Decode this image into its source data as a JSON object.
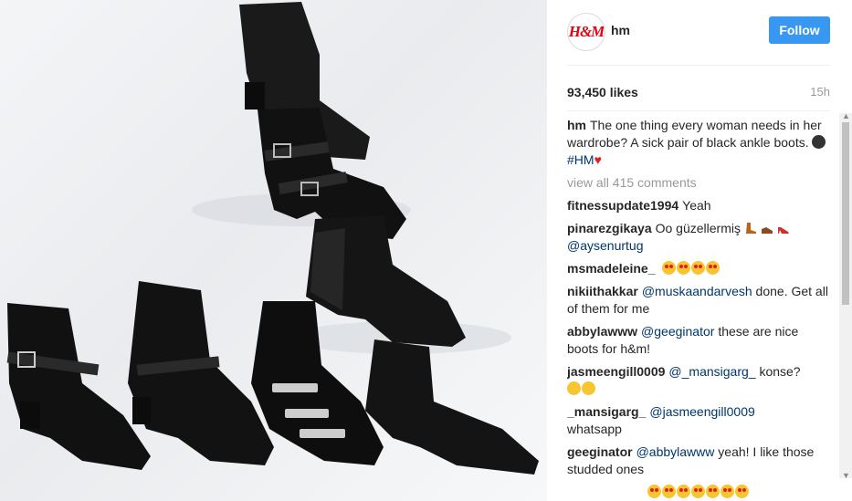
{
  "post": {
    "username": "hm",
    "avatar_text": "H&M",
    "follow_label": "Follow",
    "likes": "93,450 likes",
    "time": "15h",
    "caption_user": "hm",
    "caption_text": "The one thing every woman needs in her wardrobe? A sick pair of black ankle boots.",
    "caption_hashtag": "#HM",
    "view_all": "view all 415 comments"
  },
  "comments": [
    {
      "user": "fitnessupdate1994",
      "text": "Yeah"
    },
    {
      "user": "pinarezgikaya",
      "text": "Oo güzellermiş",
      "mention": "@aysenurtug"
    },
    {
      "user": "msmadeleine_",
      "text": ""
    },
    {
      "user": "nikiithakkar",
      "mention": "@muskaandarvesh",
      "text": "done. Get all of them for me"
    },
    {
      "user": "abbylawww",
      "mention": "@geeginator",
      "text": "these are nice boots for h&m!"
    },
    {
      "user": "jasmeengill0009",
      "mention": "@_mansigarg_",
      "text": "konse?"
    },
    {
      "user": "_mansigarg_",
      "mention": "@jasmeengill0009",
      "text": "whatsapp"
    },
    {
      "user": "geeginator",
      "mention": "@abbylawww",
      "text": "yeah! I like those studded ones"
    }
  ],
  "colors": {
    "accent": "#3897f0",
    "brand": "#e50010",
    "link": "#003569"
  }
}
